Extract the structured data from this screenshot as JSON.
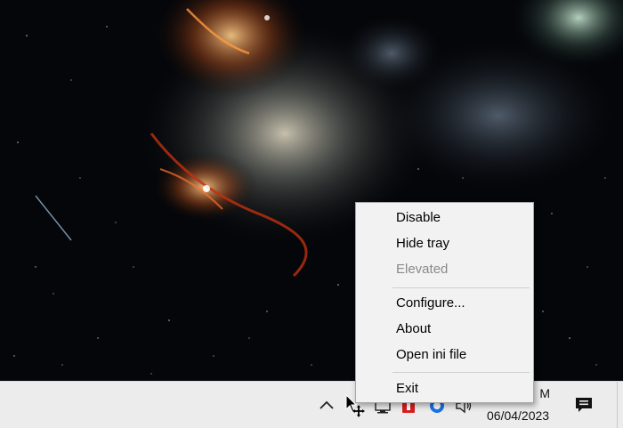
{
  "context_menu": {
    "items": [
      {
        "label": "Disable",
        "enabled": true
      },
      {
        "label": "Hide tray",
        "enabled": true
      },
      {
        "label": "Elevated",
        "enabled": false
      },
      {
        "label": "Configure...",
        "enabled": true
      },
      {
        "label": "About",
        "enabled": true
      },
      {
        "label": "Open ini file",
        "enabled": true
      },
      {
        "label": "Exit",
        "enabled": true
      }
    ]
  },
  "taskbar": {
    "clock_time": "M",
    "clock_date": "06/04/2023",
    "tray_icons": [
      "show-hidden-icons-chevron",
      "network-icon",
      "app-red-icon",
      "browser-icon",
      "volume-icon"
    ],
    "notification_icon": "action-center-icon"
  },
  "colors": {
    "taskbar_bg": "#ececec",
    "menu_bg": "#f2f2f2",
    "menu_disabled_text": "#8a8a8a",
    "tray_red_icon": "#d81e1e",
    "browser_icon_blue": "#1a73e8"
  }
}
